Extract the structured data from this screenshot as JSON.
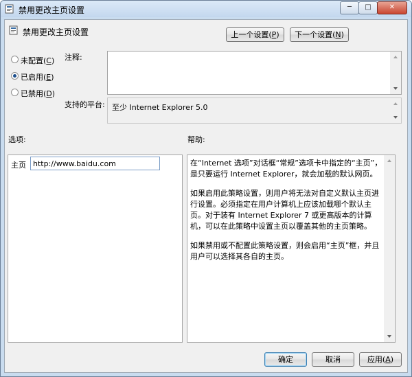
{
  "window": {
    "title": "禁用更改主页设置",
    "controls": {
      "minimize": "─",
      "maximize": "□",
      "close": "✕"
    }
  },
  "header": {
    "policy_name": "禁用更改主页设置",
    "prev_button": {
      "text": "上一个设置(",
      "key": "P",
      "end": ")"
    },
    "next_button": {
      "text": "下一个设置(",
      "key": "N",
      "end": ")"
    }
  },
  "state": {
    "options": [
      {
        "text": "未配置(",
        "key": "C",
        "end": ")",
        "selected": false
      },
      {
        "text": "已启用(",
        "key": "E",
        "end": ")",
        "selected": true
      },
      {
        "text": "已禁用(",
        "key": "D",
        "end": ")",
        "selected": false
      }
    ]
  },
  "comment": {
    "label": "注释:",
    "value": ""
  },
  "platform": {
    "label": "支持的平台:",
    "value": "至少 Internet Explorer 5.0"
  },
  "options_panel": {
    "label": "选项:",
    "homepage_label": "主页",
    "homepage_value": "http://www.baidu.com"
  },
  "help_panel": {
    "label": "帮助:",
    "paragraphs": [
      "在“Internet 选项”对话框“常规”选项卡中指定的“主页”，是只要运行 Internet Explorer，就会加载的默认网页。",
      "如果启用此策略设置，则用户将无法对自定义默认主页进行设置。必须指定在用户计算机上应该加载哪个默认主页。对于装有 Internet Explorer 7 或更高版本的计算机，可以在此策略中设置主页以覆盖其他的主页策略。",
      "如果禁用或不配置此策略设置，则会启用“主页”框，并且用户可以选择其各自的主页。"
    ]
  },
  "footer": {
    "ok": "确定",
    "cancel": "取消",
    "apply": {
      "text": "应用(",
      "key": "A",
      "end": ")"
    }
  },
  "colors": {
    "title_gradient_top": "#dceaf8",
    "client_bg": "#f0f0f0",
    "close_red": "#c94530"
  }
}
